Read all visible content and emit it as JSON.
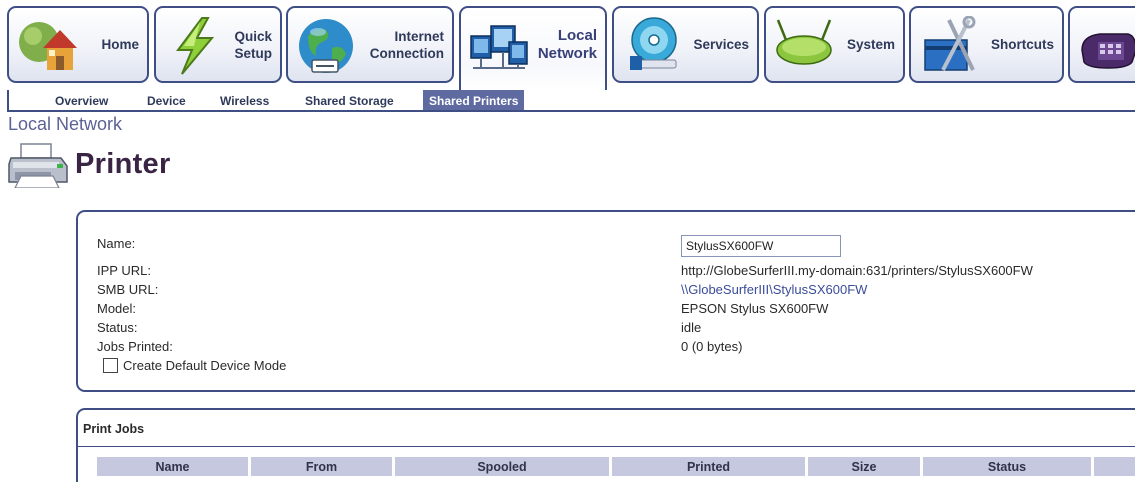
{
  "nav": {
    "tabs": [
      {
        "id": "home",
        "label": "Home",
        "icon": "home-icon"
      },
      {
        "id": "quick-setup",
        "label": "Quick\nSetup",
        "icon": "lightning-icon"
      },
      {
        "id": "internet-connection",
        "label": "Internet\nConnection",
        "icon": "globe-icon"
      },
      {
        "id": "local-network",
        "label": "Local\nNetwork",
        "icon": "network-computers-icon",
        "active": true
      },
      {
        "id": "services",
        "label": "Services",
        "icon": "disc-icon"
      },
      {
        "id": "system",
        "label": "System",
        "icon": "router-icon"
      },
      {
        "id": "shortcuts",
        "label": "Shortcuts",
        "icon": "toolbox-icon"
      },
      {
        "id": "phone",
        "label": "",
        "icon": "phone-icon"
      }
    ],
    "subtabs": [
      "Overview",
      "Device",
      "Wireless",
      "Shared Storage",
      "Shared Printers"
    ],
    "active_subtab": "Shared Printers"
  },
  "breadcrumb": "Local Network",
  "page_title": "Printer",
  "printer": {
    "name_label": "Name:",
    "name_value": "StylusSX600FW",
    "ipp_label": "IPP URL:",
    "ipp_value": "http://GlobeSurferIII.my-domain:631/printers/StylusSX600FW",
    "smb_label": "SMB URL:",
    "smb_value": "\\\\GlobeSurferIII\\StylusSX600FW",
    "model_label": "Model:",
    "model_value": "EPSON Stylus SX600FW",
    "status_label": "Status:",
    "status_value": "idle",
    "jobs_label": "Jobs Printed:",
    "jobs_value": "0 (0 bytes)",
    "default_mode_label": "Create Default Device Mode",
    "default_mode_checked": false
  },
  "print_jobs": {
    "title": "Print Jobs",
    "columns": [
      "Name",
      "From",
      "Spooled",
      "Printed",
      "Size",
      "Status"
    ]
  },
  "colors": {
    "border": "#3f4f86",
    "active_subtab": "#5f6aa0",
    "table_header": "#c5c8de",
    "link": "#3a4c9a"
  }
}
